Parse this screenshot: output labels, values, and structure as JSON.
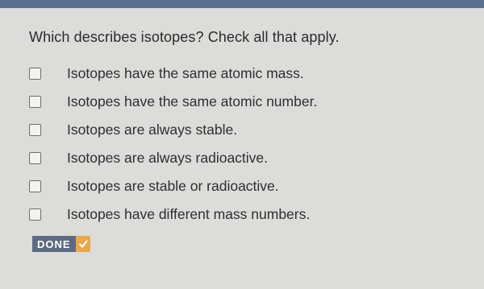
{
  "question": {
    "text": "Which describes isotopes? Check all that apply."
  },
  "options": [
    {
      "label": "Isotopes have the same atomic mass.",
      "checked": false
    },
    {
      "label": "Isotopes have the same atomic number.",
      "checked": false
    },
    {
      "label": "Isotopes are always stable.",
      "checked": false
    },
    {
      "label": "Isotopes are always radioactive.",
      "checked": false
    },
    {
      "label": "Isotopes are stable or radioactive.",
      "checked": false
    },
    {
      "label": "Isotopes have different mass numbers.",
      "checked": false
    }
  ],
  "done_button": {
    "label": "DONE",
    "icon": "checkmark-icon"
  },
  "colors": {
    "top_strip": "#5b6f8f",
    "done_bg": "#5d6a82",
    "done_check_bg": "#e9a84a"
  }
}
